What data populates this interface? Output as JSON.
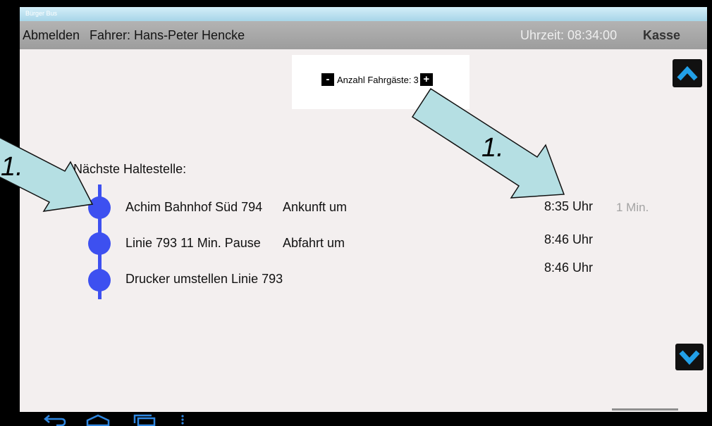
{
  "app": {
    "title": "Bürger Bus"
  },
  "header": {
    "logout_label": "Abmelden",
    "driver_label": "Fahrer: Hans-Peter Hencke",
    "time_label": "Uhrzeit: 08:34:00",
    "cashier_label": "Kasse"
  },
  "passengers": {
    "minus_label": "-",
    "label": "Anzahl Fahrgäste:",
    "count": "3",
    "plus_label": "+"
  },
  "next_stop": {
    "heading": "Nächste Haltestelle:",
    "stops": [
      {
        "name": "Achim Bahnhof Süd 794",
        "action": "Ankunft um",
        "time": "8:35 Uhr",
        "countdown": "1 Min."
      },
      {
        "name": "Linie 793 11 Min. Pause",
        "action": "Abfahrt um",
        "time": "8:46 Uhr"
      },
      {
        "name": "Drucker umstellen Linie 793",
        "time": "8:46 Uhr"
      }
    ]
  },
  "scroll": {
    "up_icon": "chevron-up-icon",
    "down_icon": "chevron-down-icon"
  },
  "annotations": [
    {
      "label": "1."
    },
    {
      "label": "1."
    }
  ],
  "nav_bar": {
    "icons": [
      "back-icon",
      "home-icon",
      "recent-apps-icon",
      "menu-icon"
    ]
  },
  "colors": {
    "header": "#a6a6a6",
    "content_background": "#f3efef",
    "timeline": "#3d50f0",
    "scroll_chevron": "#22a0e8",
    "annotation_fill": "#b5dfe3",
    "nav_icons": "#2f86e0"
  }
}
